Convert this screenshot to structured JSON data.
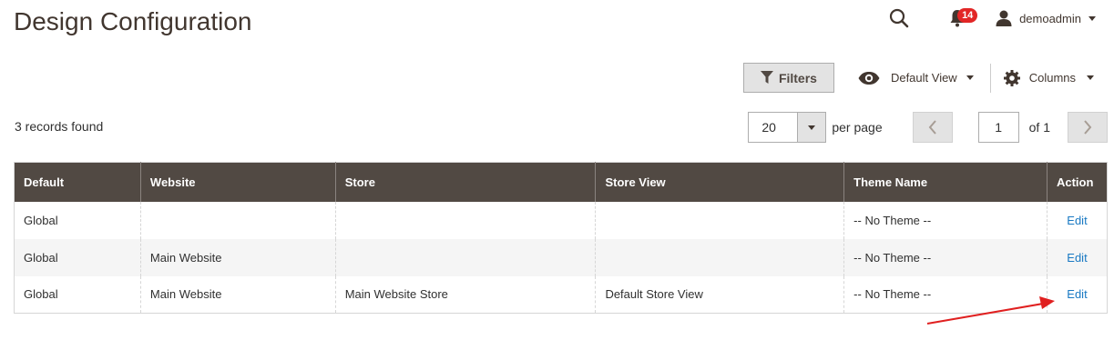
{
  "page": {
    "title": "Design Configuration"
  },
  "header": {
    "notification_count": "14",
    "username": "demoadmin"
  },
  "toolbar": {
    "filters_label": "Filters",
    "view_label": "Default View",
    "columns_label": "Columns"
  },
  "records_found": "3 records found",
  "pager": {
    "per_page_value": "20",
    "per_page_label": "per page",
    "current_page": "1",
    "of_label": "of 1"
  },
  "grid": {
    "columns": [
      "Default",
      "Website",
      "Store",
      "Store View",
      "Theme Name",
      "Action"
    ],
    "rows": [
      {
        "default": "Global",
        "website": "",
        "store": "",
        "store_view": "",
        "theme": "-- No Theme --",
        "action": "Edit"
      },
      {
        "default": "Global",
        "website": "Main Website",
        "store": "",
        "store_view": "",
        "theme": "-- No Theme --",
        "action": "Edit"
      },
      {
        "default": "Global",
        "website": "Main Website",
        "store": "Main Website Store",
        "store_view": "Default Store View",
        "theme": "-- No Theme --",
        "action": "Edit"
      }
    ]
  },
  "icons": {
    "search": "search-icon",
    "notifications": "bell-icon",
    "user": "user-icon",
    "filter": "funnel-icon",
    "view": "eye-icon",
    "columns": "gear-icon"
  },
  "colors": {
    "header_bg": "#514943",
    "link": "#1979c3",
    "badge": "#e22626",
    "annotation_arrow": "#e02020"
  }
}
